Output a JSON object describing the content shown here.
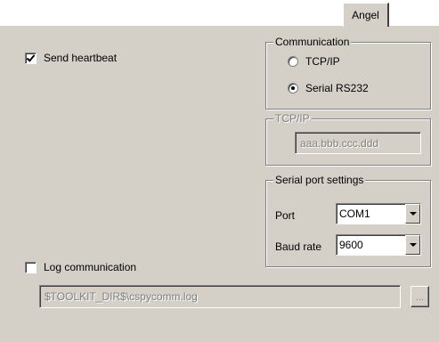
{
  "tab": {
    "label": "Angel"
  },
  "heartbeat": {
    "label": "Send heartbeat",
    "checked": true
  },
  "communication": {
    "title": "Communication",
    "options": [
      {
        "label": "TCP/IP",
        "selected": false
      },
      {
        "label": "Serial RS232",
        "selected": true
      }
    ]
  },
  "tcpip": {
    "title": "TCP/IP",
    "address": "aaa.bbb.ccc.ddd",
    "enabled": false
  },
  "serial": {
    "title": "Serial port settings",
    "port_label": "Port",
    "port_value": "COM1",
    "baud_label": "Baud rate",
    "baud_value": "9600"
  },
  "log": {
    "label": "Log communication",
    "checked": false,
    "path": "$TOOLKIT_DIR$\\cspycomm.log",
    "browse_label": "..."
  }
}
